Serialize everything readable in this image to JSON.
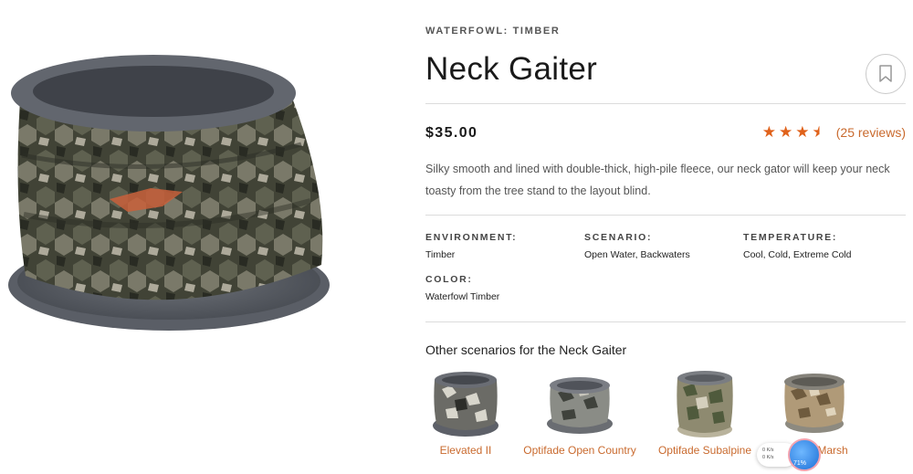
{
  "product": {
    "breadcrumb": "WATERFOWL: TIMBER",
    "title": "Neck Gaiter",
    "price": "$35.00",
    "rating": 3.5,
    "reviews_text": "(25 reviews)",
    "description": "Silky smooth and lined with double-thick, high-pile fleece, our neck gator will keep your neck toasty from the tree stand to the layout blind.",
    "hero_image_alt": "neck gaiter camo"
  },
  "specs": {
    "environment": {
      "label": "ENVIRONMENT:",
      "value": "Timber"
    },
    "scenario": {
      "label": "SCENARIO:",
      "value": "Open Water, Backwaters"
    },
    "temperature": {
      "label": "TEMPERATURE:",
      "value": "Cool, Cold, Extreme Cold"
    },
    "color": {
      "label": "COLOR:",
      "value": "Waterfowl Timber"
    }
  },
  "other_scenarios": {
    "title": "Other scenarios for the Neck Gaiter",
    "items": [
      {
        "label": "Elevated II"
      },
      {
        "label": "Optifade Open Country"
      },
      {
        "label": "Optifade Subalpine"
      },
      {
        "label": "Marsh"
      }
    ]
  },
  "widget": {
    "line1": "0  K/s",
    "line2": "0  K/s",
    "percent": "71%"
  },
  "colors": {
    "accent": "#c96a2e",
    "star": "#e0621b",
    "rule": "#dcdcdc"
  }
}
